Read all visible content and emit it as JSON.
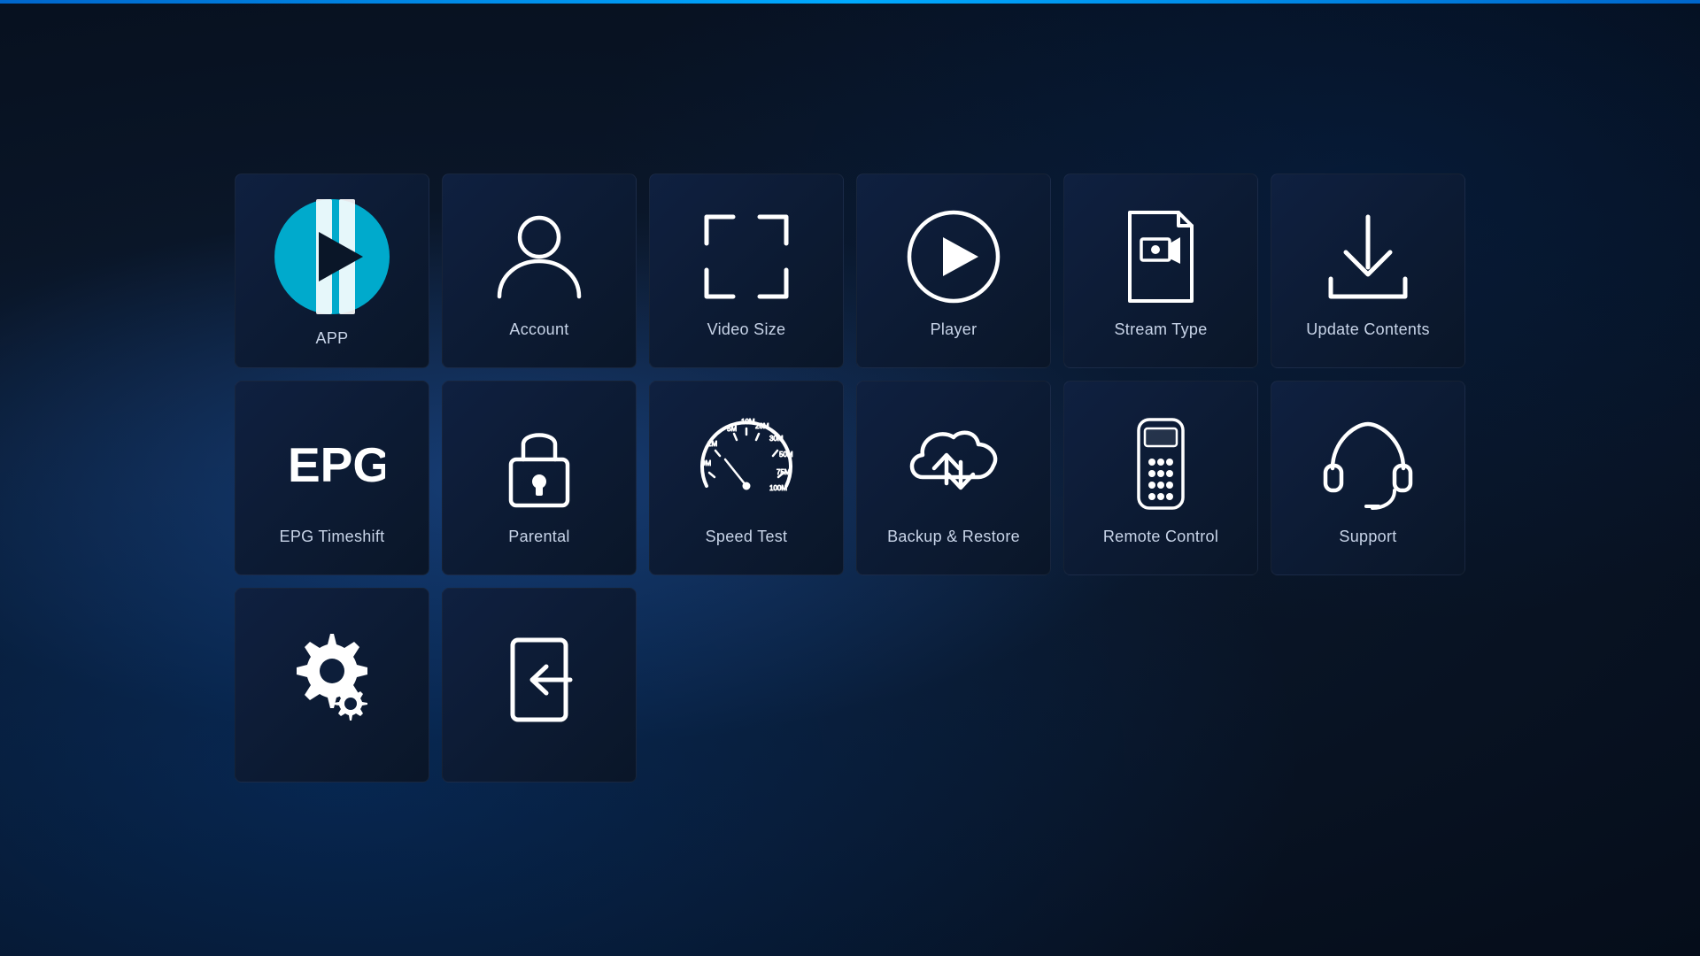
{
  "tiles": [
    {
      "id": "app",
      "label": "APP",
      "icon": "app"
    },
    {
      "id": "account",
      "label": "Account",
      "icon": "account"
    },
    {
      "id": "video-size",
      "label": "Video Size",
      "icon": "video-size"
    },
    {
      "id": "player",
      "label": "Player",
      "icon": "player"
    },
    {
      "id": "stream-type",
      "label": "Stream Type",
      "icon": "stream-type"
    },
    {
      "id": "update-contents",
      "label": "Update Contents",
      "icon": "update-contents"
    },
    {
      "id": "epg-timeshift",
      "label": "EPG Timeshift",
      "icon": "epg"
    },
    {
      "id": "parental",
      "label": "Parental",
      "icon": "parental"
    },
    {
      "id": "speed-test",
      "label": "Speed Test",
      "icon": "speed-test"
    },
    {
      "id": "backup-restore",
      "label": "Backup & Restore",
      "icon": "backup-restore"
    },
    {
      "id": "remote-control",
      "label": "Remote Control",
      "icon": "remote-control"
    },
    {
      "id": "support",
      "label": "Support",
      "icon": "support"
    },
    {
      "id": "settings",
      "label": "",
      "icon": "settings"
    },
    {
      "id": "logout",
      "label": "",
      "icon": "logout"
    }
  ]
}
